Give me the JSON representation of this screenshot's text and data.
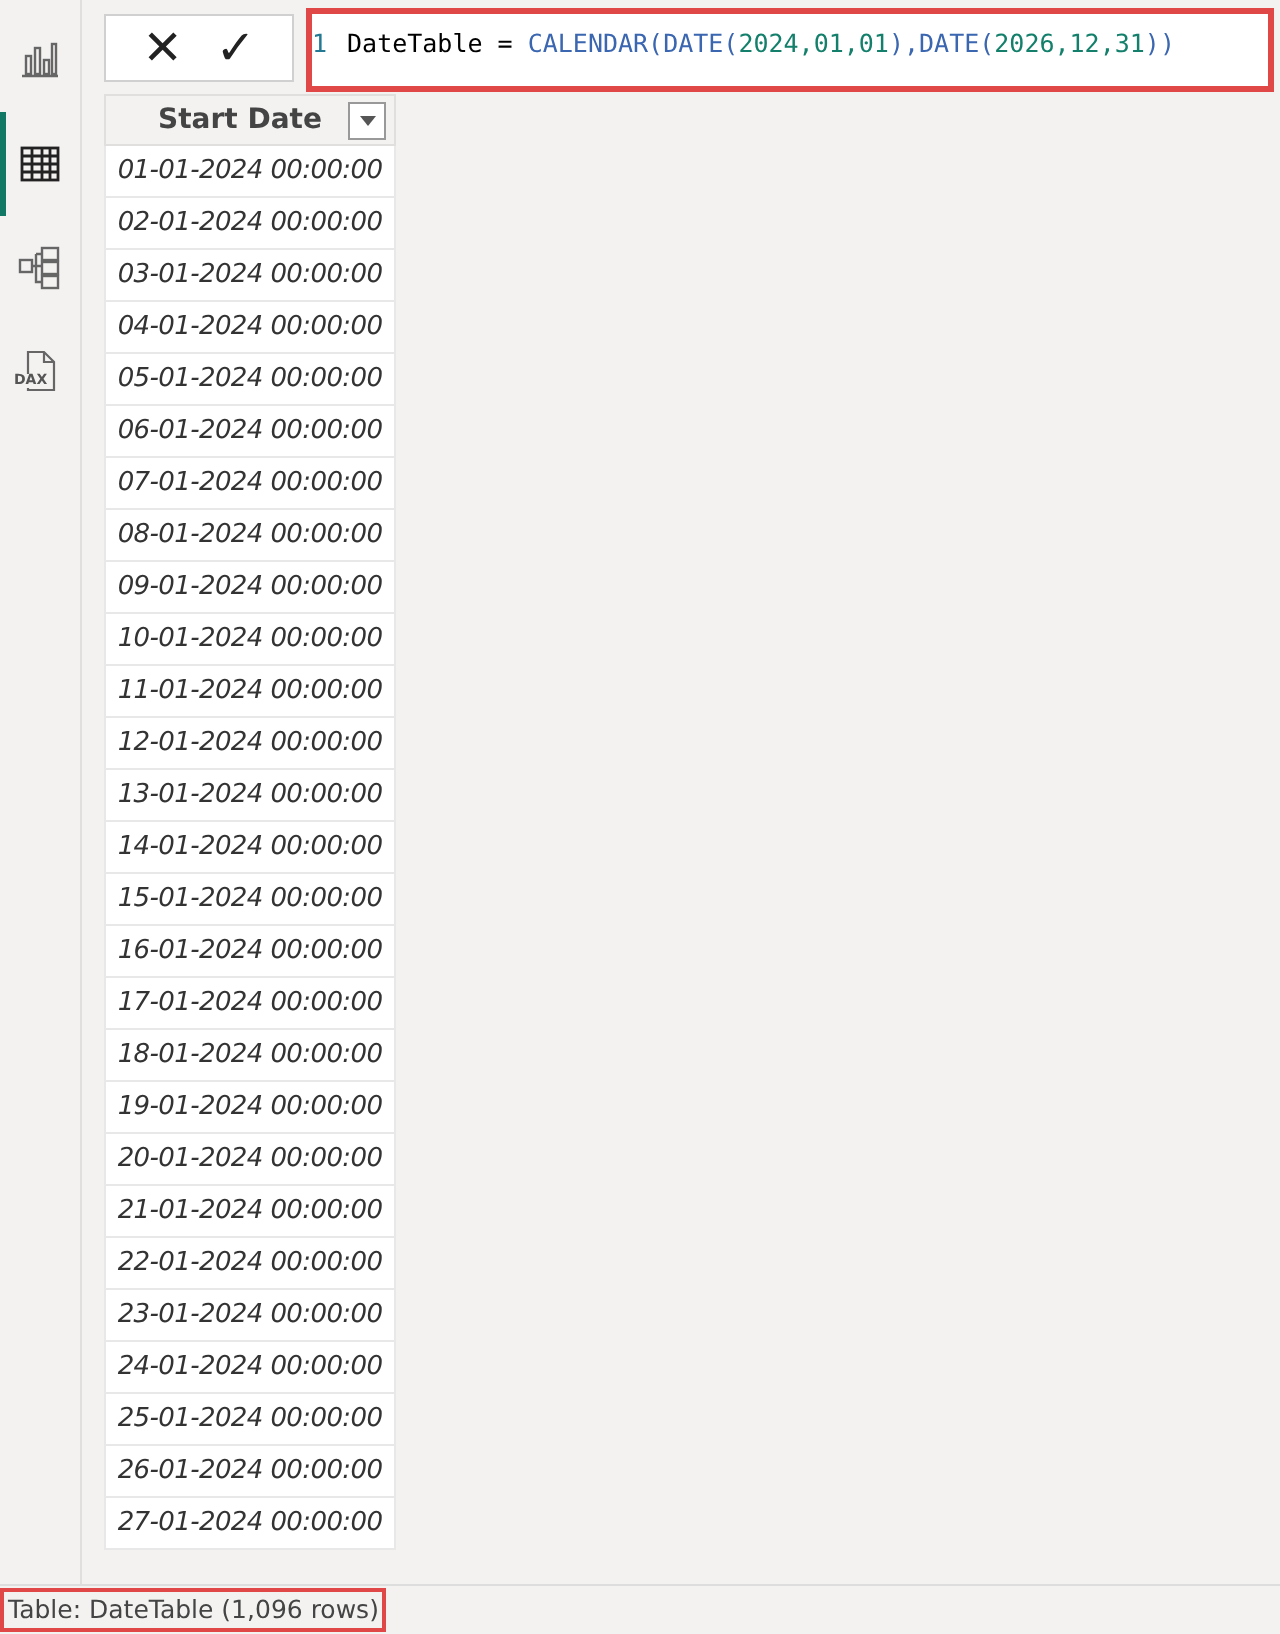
{
  "rail": [
    {
      "kind": "report",
      "selected": false
    },
    {
      "kind": "table",
      "selected": true
    },
    {
      "kind": "model",
      "selected": false
    },
    {
      "kind": "dax",
      "label": "DAX",
      "selected": false
    }
  ],
  "formula_bar": {
    "cancel": "✕",
    "commit": "✓",
    "line_number": "1",
    "tokens": [
      {
        "kind": "plain",
        "text": "DateTable = "
      },
      {
        "kind": "func",
        "text": "CALENDAR(DATE("
      },
      {
        "kind": "number",
        "text": "2024,01,01"
      },
      {
        "kind": "func",
        "text": "),DATE("
      },
      {
        "kind": "number",
        "text": "2026,12,31"
      },
      {
        "kind": "func",
        "text": "))"
      }
    ]
  },
  "table": {
    "columns": [
      "Start Date"
    ],
    "rows": [
      "01-01-2024 00:00:00",
      "02-01-2024 00:00:00",
      "03-01-2024 00:00:00",
      "04-01-2024 00:00:00",
      "05-01-2024 00:00:00",
      "06-01-2024 00:00:00",
      "07-01-2024 00:00:00",
      "08-01-2024 00:00:00",
      "09-01-2024 00:00:00",
      "10-01-2024 00:00:00",
      "11-01-2024 00:00:00",
      "12-01-2024 00:00:00",
      "13-01-2024 00:00:00",
      "14-01-2024 00:00:00",
      "15-01-2024 00:00:00",
      "16-01-2024 00:00:00",
      "17-01-2024 00:00:00",
      "18-01-2024 00:00:00",
      "19-01-2024 00:00:00",
      "20-01-2024 00:00:00",
      "21-01-2024 00:00:00",
      "22-01-2024 00:00:00",
      "23-01-2024 00:00:00",
      "24-01-2024 00:00:00",
      "25-01-2024 00:00:00",
      "26-01-2024 00:00:00",
      "27-01-2024 00:00:00"
    ]
  },
  "status_bar": "Table: DateTable (1,096 rows)"
}
